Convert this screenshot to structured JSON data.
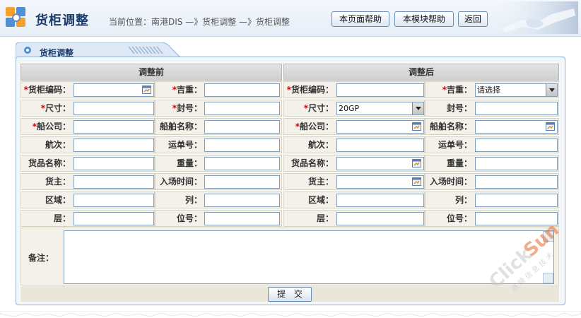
{
  "header": {
    "title": "货柜调整",
    "breadcrumb": "当前位置：南港DIS —》货柜调整 —》货柜调整",
    "buttons": {
      "page_help": "本页面帮助",
      "module_help": "本模块帮助",
      "back": "返回"
    }
  },
  "panel": {
    "tab_label": "货柜调整"
  },
  "before": {
    "heading": "调整前",
    "fields": {
      "container_no": "货柜编码：",
      "gross_weight": "吉重：",
      "size": "尺寸：",
      "seal_no": "封号：",
      "shipping_company": "船公司：",
      "vessel_name": "船舶名称：",
      "voyage": "航次：",
      "waybill_no": "运单号：",
      "goods_name": "货品名称：",
      "weight": "重量：",
      "owner": "货主：",
      "entry_time": "入场时间：",
      "area": "区域：",
      "column": "列：",
      "tier": "层：",
      "position_no": "位号："
    }
  },
  "after": {
    "heading": "调整后",
    "fields": {
      "container_no": "货柜编码：",
      "gross_weight": "吉重：",
      "size": "尺寸：",
      "seal_no": "封号：",
      "shipping_company": "船公司：",
      "vessel_name": "船舶名称：",
      "voyage": "航次：",
      "waybill_no": "运单号：",
      "goods_name": "货品名称：",
      "weight": "重量：",
      "owner": "货主：",
      "entry_time": "入场时间：",
      "area": "区域：",
      "column": "列：",
      "tier": "层：",
      "position_no": "位号："
    },
    "values": {
      "gross_weight": "请选择",
      "size": "20GP"
    }
  },
  "remarks": {
    "label": "备注："
  },
  "submit": {
    "label": "提 交"
  },
  "required_marker": "*",
  "watermark": {
    "text": "ClickSun",
    "subtitle": "点 睛 信 息 技 术"
  },
  "colors": {
    "accent": "#1c3e6e",
    "required": "#d00000",
    "watermark": "#e46b2b"
  }
}
